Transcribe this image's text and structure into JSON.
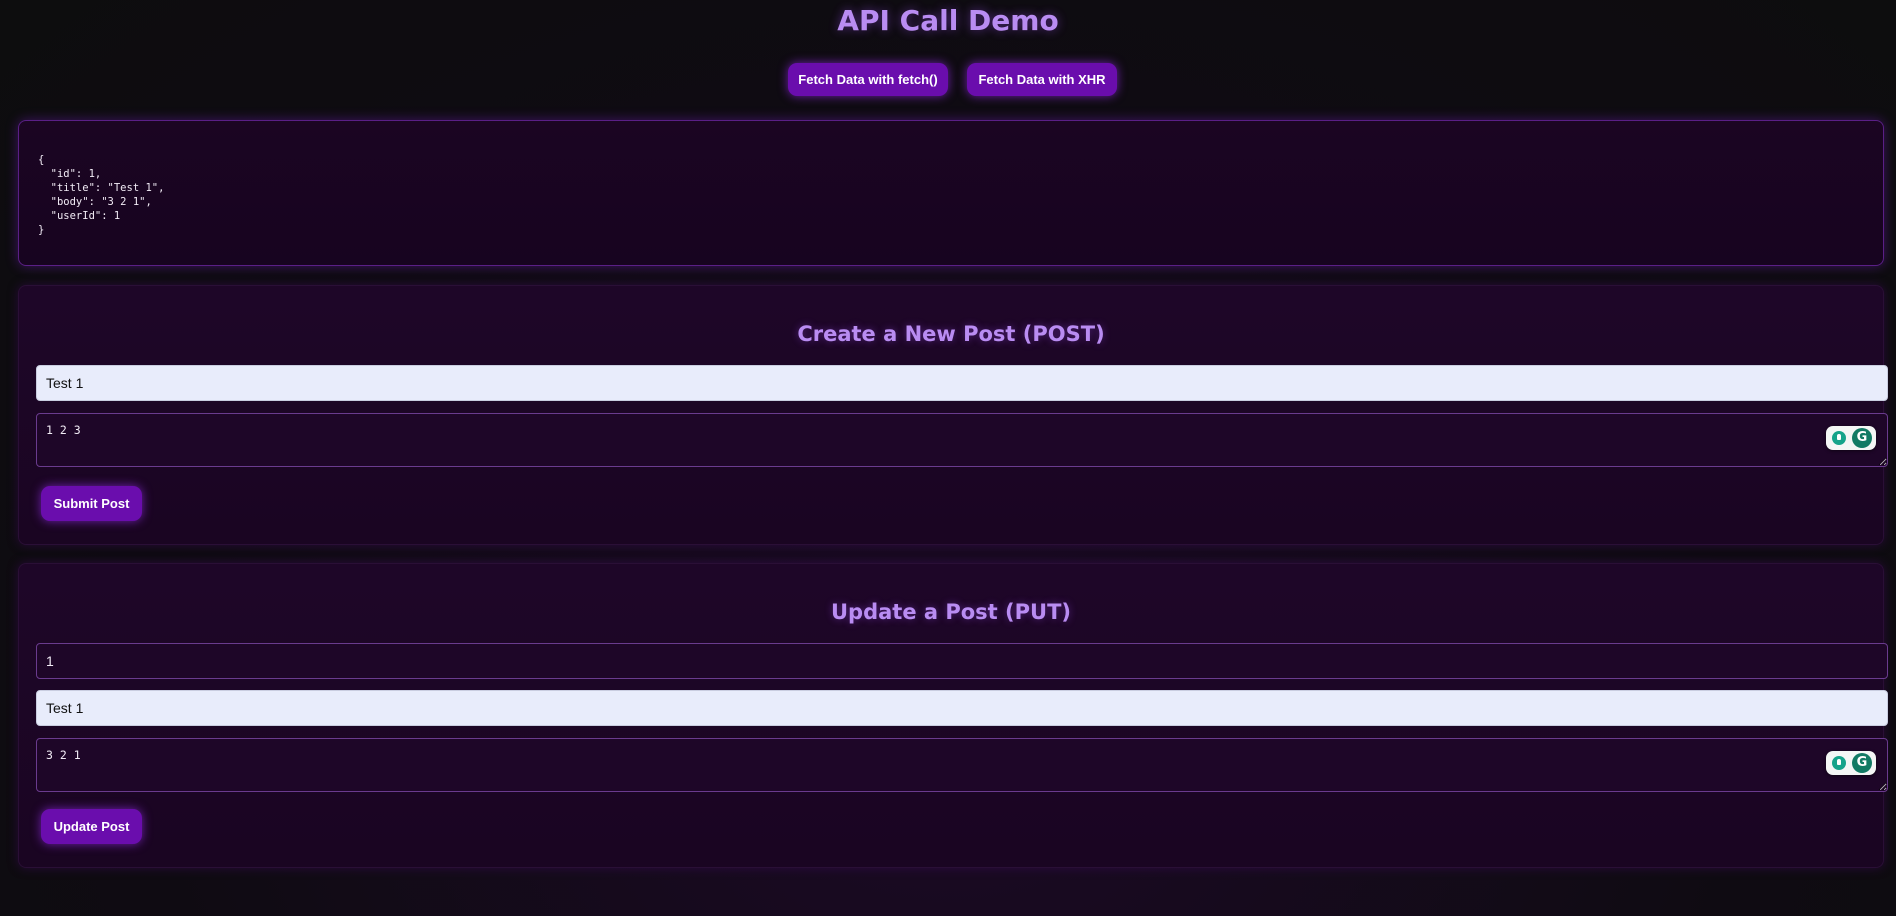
{
  "header": {
    "title": "API Call Demo"
  },
  "toolbar": {
    "fetch_label": "Fetch Data with fetch()",
    "xhr_label": "Fetch Data with XHR"
  },
  "output": {
    "json_text": "{\n  \"id\": 1,\n  \"title\": \"Test 1\",\n  \"body\": \"3 2 1\",\n  \"userId\": 1\n}"
  },
  "post_form": {
    "heading": "Create a New Post (POST)",
    "title_value": "Test 1",
    "body_value": "1 2 3",
    "submit_label": "Submit Post"
  },
  "put_form": {
    "heading": "Update a Post (PUT)",
    "id_value": "1",
    "title_value": "Test 1",
    "body_value": "3 2 1",
    "submit_label": "Update Post"
  },
  "extension": {
    "logo_letter": "G"
  },
  "colors": {
    "accent": "#6a0dad",
    "heading": "#b98cf2",
    "panel_bg": "#1e0628",
    "input_light": "#e8ecfb",
    "grammarly_green": "#15a38a"
  },
  "icons": {
    "assistant_icon": "grammarly-bulb-icon",
    "assistant_logo": "grammarly-logo-icon"
  }
}
